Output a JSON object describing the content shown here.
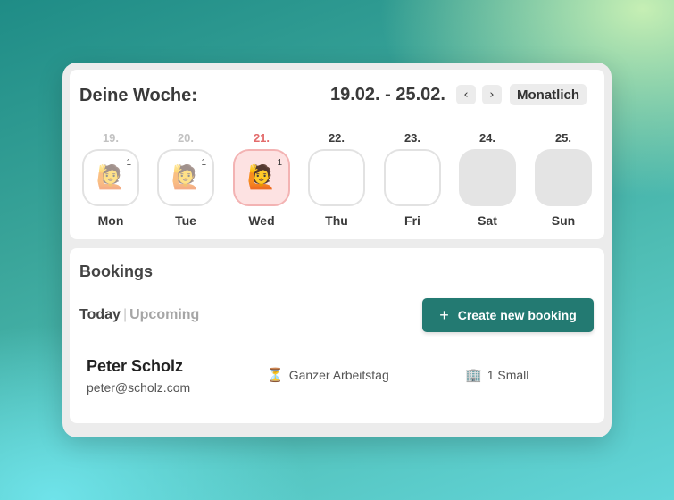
{
  "week": {
    "title": "Deine Woche:",
    "range": "19.02. - 25.02.",
    "prev_icon": "‹",
    "next_icon": "›",
    "view_label": "Monatlich",
    "days": [
      {
        "date": "19.",
        "name": "Mon",
        "state": "past",
        "emoji": "🙋",
        "count": "1"
      },
      {
        "date": "20.",
        "name": "Tue",
        "state": "past",
        "emoji": "🙋",
        "count": "1"
      },
      {
        "date": "21.",
        "name": "Wed",
        "state": "today",
        "emoji": "🙋",
        "count": "1"
      },
      {
        "date": "22.",
        "name": "Thu",
        "state": "future",
        "emoji": "",
        "count": ""
      },
      {
        "date": "23.",
        "name": "Fri",
        "state": "future",
        "emoji": "",
        "count": ""
      },
      {
        "date": "24.",
        "name": "Sat",
        "state": "weekend",
        "emoji": "",
        "count": ""
      },
      {
        "date": "25.",
        "name": "Sun",
        "state": "weekend",
        "emoji": "",
        "count": ""
      }
    ]
  },
  "bookings": {
    "title": "Bookings",
    "tab_today": "Today",
    "tab_separator": "|",
    "tab_upcoming": "Upcoming",
    "create_icon": "+",
    "create_label": "Create new booking",
    "items": [
      {
        "name": "Peter Scholz",
        "email": "peter@scholz.com",
        "duration_icon": "⏳",
        "duration": "Ganzer Arbeitstag",
        "room_icon": "🏢",
        "room": "1 Small"
      }
    ]
  },
  "colors": {
    "accent": "#237a72",
    "today": "#e36b6b",
    "today_bg": "#fde2e2",
    "weekend_bg": "#e4e4e4"
  }
}
